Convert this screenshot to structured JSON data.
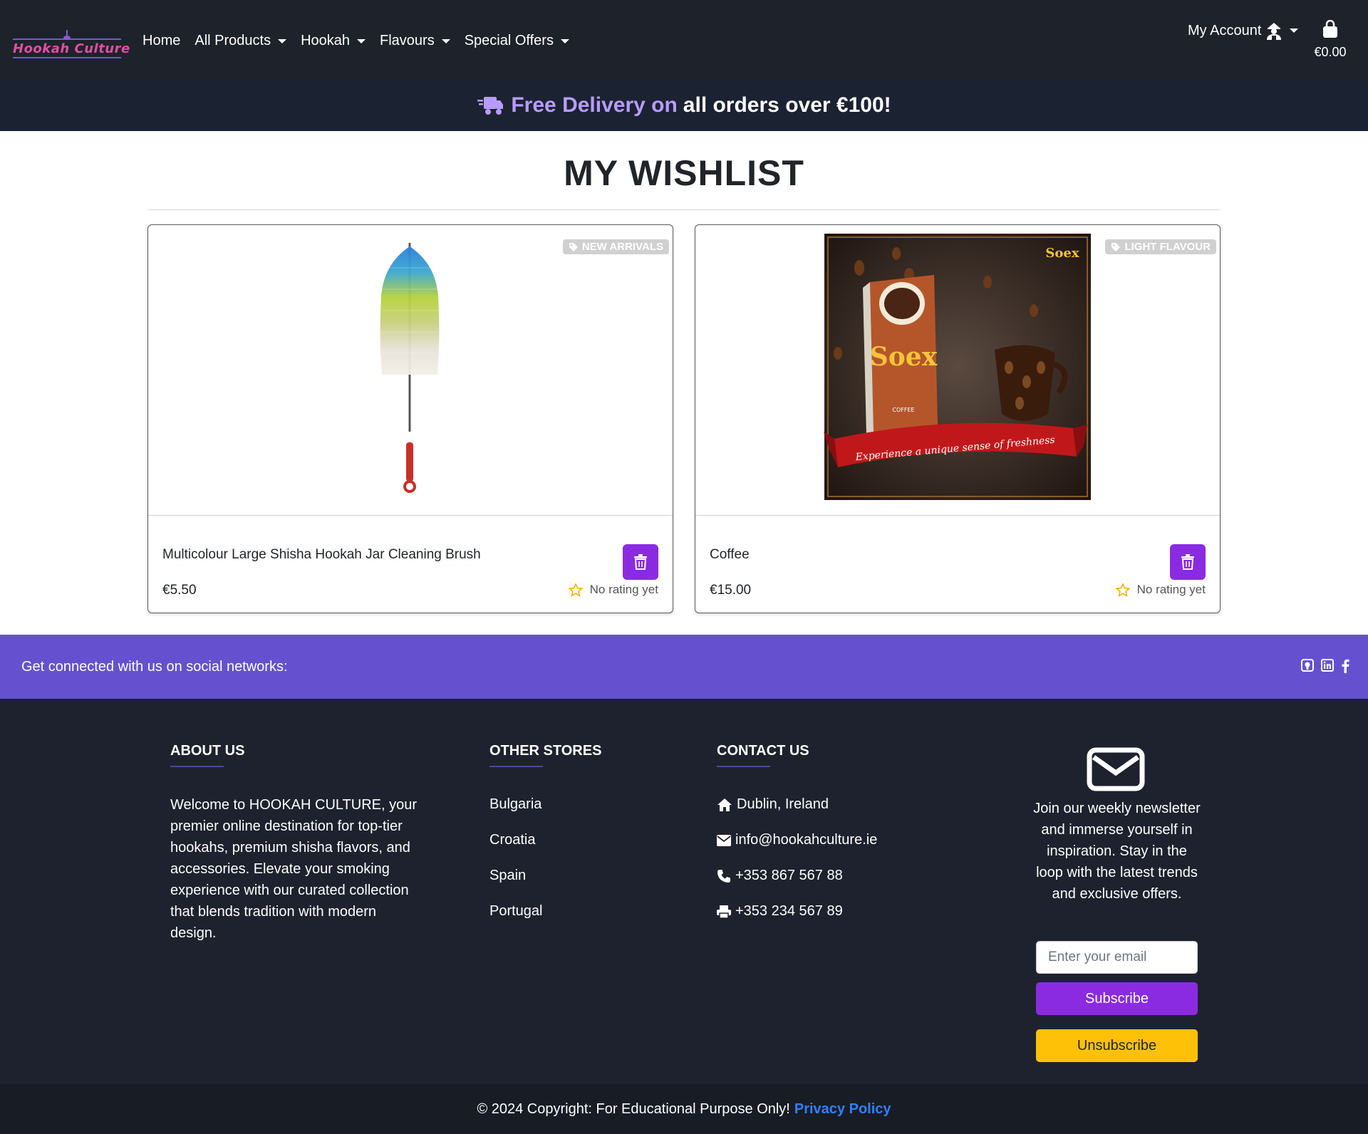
{
  "nav": {
    "logo_text": "Hookah Culture",
    "links": [
      {
        "label": "Home",
        "dropdown": false
      },
      {
        "label": "All Products",
        "dropdown": true
      },
      {
        "label": "Hookah",
        "dropdown": true
      },
      {
        "label": "Flavours",
        "dropdown": true
      },
      {
        "label": "Special Offers",
        "dropdown": true
      }
    ],
    "account_label": "My Account",
    "cart_total": "€0.00"
  },
  "banner": {
    "highlight": "Free Delivery on",
    "rest": "all orders over €100!"
  },
  "page_title": "MY WISHLIST",
  "products": [
    {
      "badge": "NEW ARRIVALS",
      "name": "Multicolour Large Shisha Hookah Jar Cleaning Brush",
      "price": "€5.50",
      "rating": "No rating yet"
    },
    {
      "badge": "LIGHT FLAVOUR",
      "name": "Coffee",
      "price": "€15.00",
      "rating": "No rating yet",
      "image_text": {
        "brand": "Soex",
        "flavour": "COFFEE",
        "ribbon": "Experience a unique sense of freshness"
      }
    }
  ],
  "social": {
    "text": "Get connected with us on social networks:",
    "icons": [
      "github-icon",
      "linkedin-icon",
      "facebook-icon"
    ]
  },
  "footer": {
    "about": {
      "heading": "ABOUT US",
      "text": "Welcome to HOOKAH CULTURE, your premier online destination for top-tier hookahs, premium shisha flavors, and accessories. Elevate your smoking experience with our curated collection that blends tradition with modern design."
    },
    "stores": {
      "heading": "OTHER STORES",
      "items": [
        "Bulgaria",
        "Croatia",
        "Spain",
        "Portugal"
      ]
    },
    "contact": {
      "heading": "CONTACT US",
      "address": "Dublin, Ireland",
      "email": "info@hookahculture.ie",
      "phone": "+353 867 567 88",
      "fax": "+353 234 567 89"
    },
    "newsletter": {
      "text": "Join our weekly newsletter and immerse yourself in inspiration. Stay in the loop with the latest trends and exclusive offers.",
      "placeholder": "Enter your email",
      "subscribe_label": "Subscribe",
      "unsubscribe_label": "Unsubscribe"
    }
  },
  "copyright": {
    "text": "© 2024 Copyright: For Educational Purpose Only!",
    "link": "Privacy Policy"
  },
  "colors": {
    "navbar": "#1e222b",
    "accent_purple": "#8a2be2",
    "social_bar": "#6551d0",
    "footer": "#1e222e",
    "unsubscribe": "#ffc107",
    "banner_highlight": "#b79cff"
  }
}
